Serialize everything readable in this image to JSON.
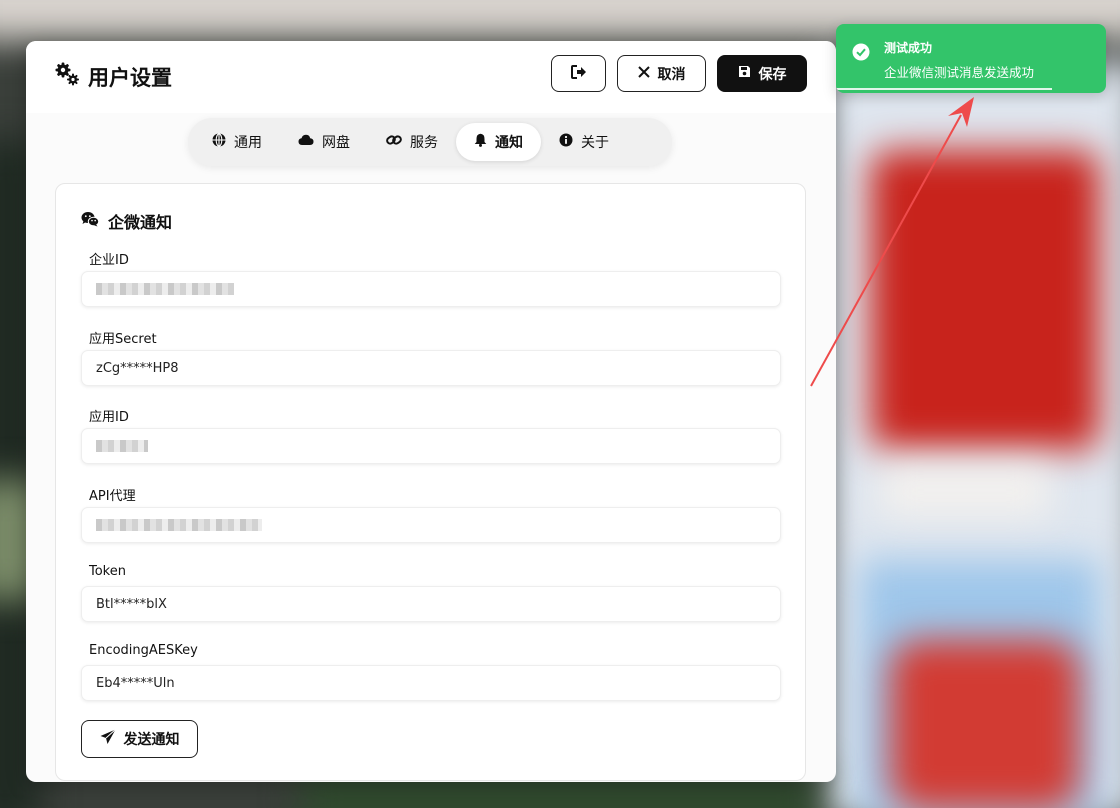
{
  "header": {
    "title": "用户设置",
    "cancel_label": "取消",
    "save_label": "保存"
  },
  "tabs": [
    {
      "label": "通用",
      "icon": "globe-icon"
    },
    {
      "label": "网盘",
      "icon": "cloud-icon"
    },
    {
      "label": "服务",
      "icon": "link-icon"
    },
    {
      "label": "通知",
      "icon": "bell-icon",
      "active": true
    },
    {
      "label": "关于",
      "icon": "info-icon"
    }
  ],
  "section": {
    "title": "企微通知",
    "fields": [
      {
        "label": "企业ID",
        "value": "",
        "masked": true
      },
      {
        "label": "应用Secret",
        "value": "zCg*****HP8"
      },
      {
        "label": "应用ID",
        "value": "",
        "masked": true
      },
      {
        "label": "API代理",
        "value": "",
        "masked": true
      },
      {
        "label": "Token",
        "value": "Btl*****blX"
      },
      {
        "label": "EncodingAESKey",
        "value": "Eb4*****Uln"
      }
    ],
    "send_label": "发送通知"
  },
  "toast": {
    "title": "测试成功",
    "message": "企业微信测试消息发送成功",
    "progress": 0.8
  },
  "colors": {
    "toast_bg": "#33c46a",
    "primary": "#111111",
    "annotation_arrow": "#ee4b4b"
  }
}
